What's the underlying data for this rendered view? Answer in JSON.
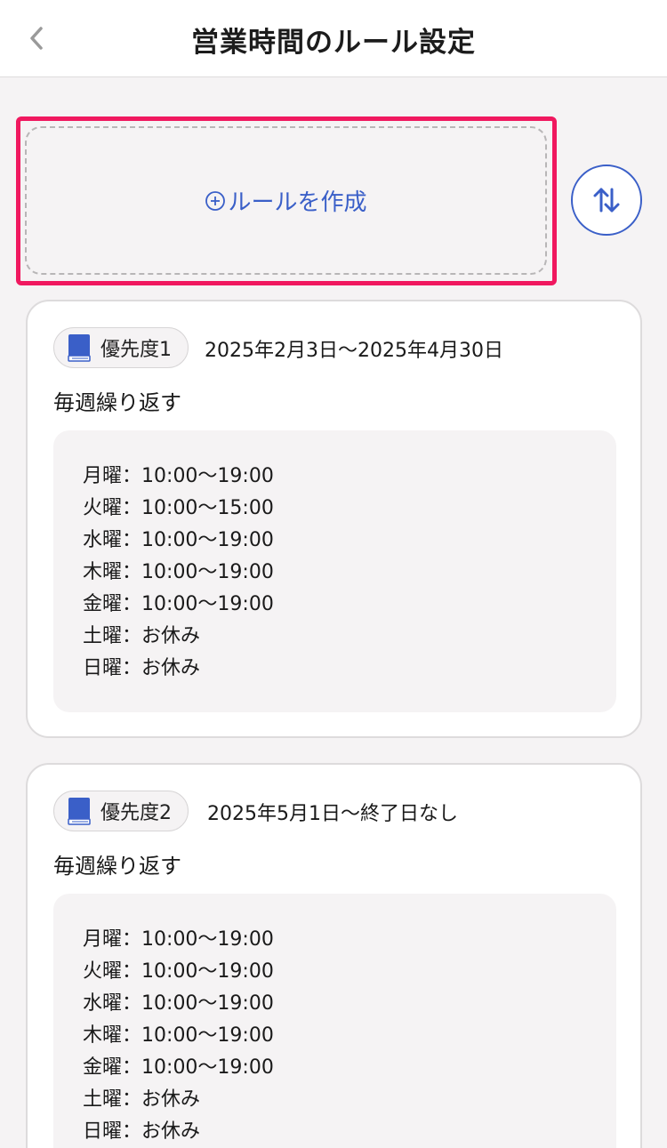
{
  "header": {
    "title": "営業時間のルール設定",
    "back_icon": "chevron-left-icon"
  },
  "create": {
    "label": "ルールを作成",
    "icon": "plus-circle-icon",
    "highlight_color": "#f0185f"
  },
  "sort": {
    "icon": "swap-vertical-icon"
  },
  "accent_color": "#3a5fc8",
  "rules": [
    {
      "priority_label": "優先度1",
      "date_range": "2025年2月3日〜2025年4月30日",
      "repeat": "毎週繰り返す",
      "schedule": [
        {
          "day": "月曜",
          "time": "10:00〜19:00"
        },
        {
          "day": "火曜",
          "time": "10:00〜15:00"
        },
        {
          "day": "水曜",
          "time": "10:00〜19:00"
        },
        {
          "day": "木曜",
          "time": "10:00〜19:00"
        },
        {
          "day": "金曜",
          "time": "10:00〜19:00"
        },
        {
          "day": "土曜",
          "time": "お休み"
        },
        {
          "day": "日曜",
          "time": "お休み"
        }
      ]
    },
    {
      "priority_label": "優先度2",
      "date_range": "2025年5月1日〜終了日なし",
      "repeat": "毎週繰り返す",
      "schedule": [
        {
          "day": "月曜",
          "time": "10:00〜19:00"
        },
        {
          "day": "火曜",
          "time": "10:00〜19:00"
        },
        {
          "day": "水曜",
          "time": "10:00〜19:00"
        },
        {
          "day": "木曜",
          "time": "10:00〜19:00"
        },
        {
          "day": "金曜",
          "time": "10:00〜19:00"
        },
        {
          "day": "土曜",
          "time": "お休み"
        },
        {
          "day": "日曜",
          "time": "お休み"
        }
      ]
    }
  ],
  "separator": "："
}
